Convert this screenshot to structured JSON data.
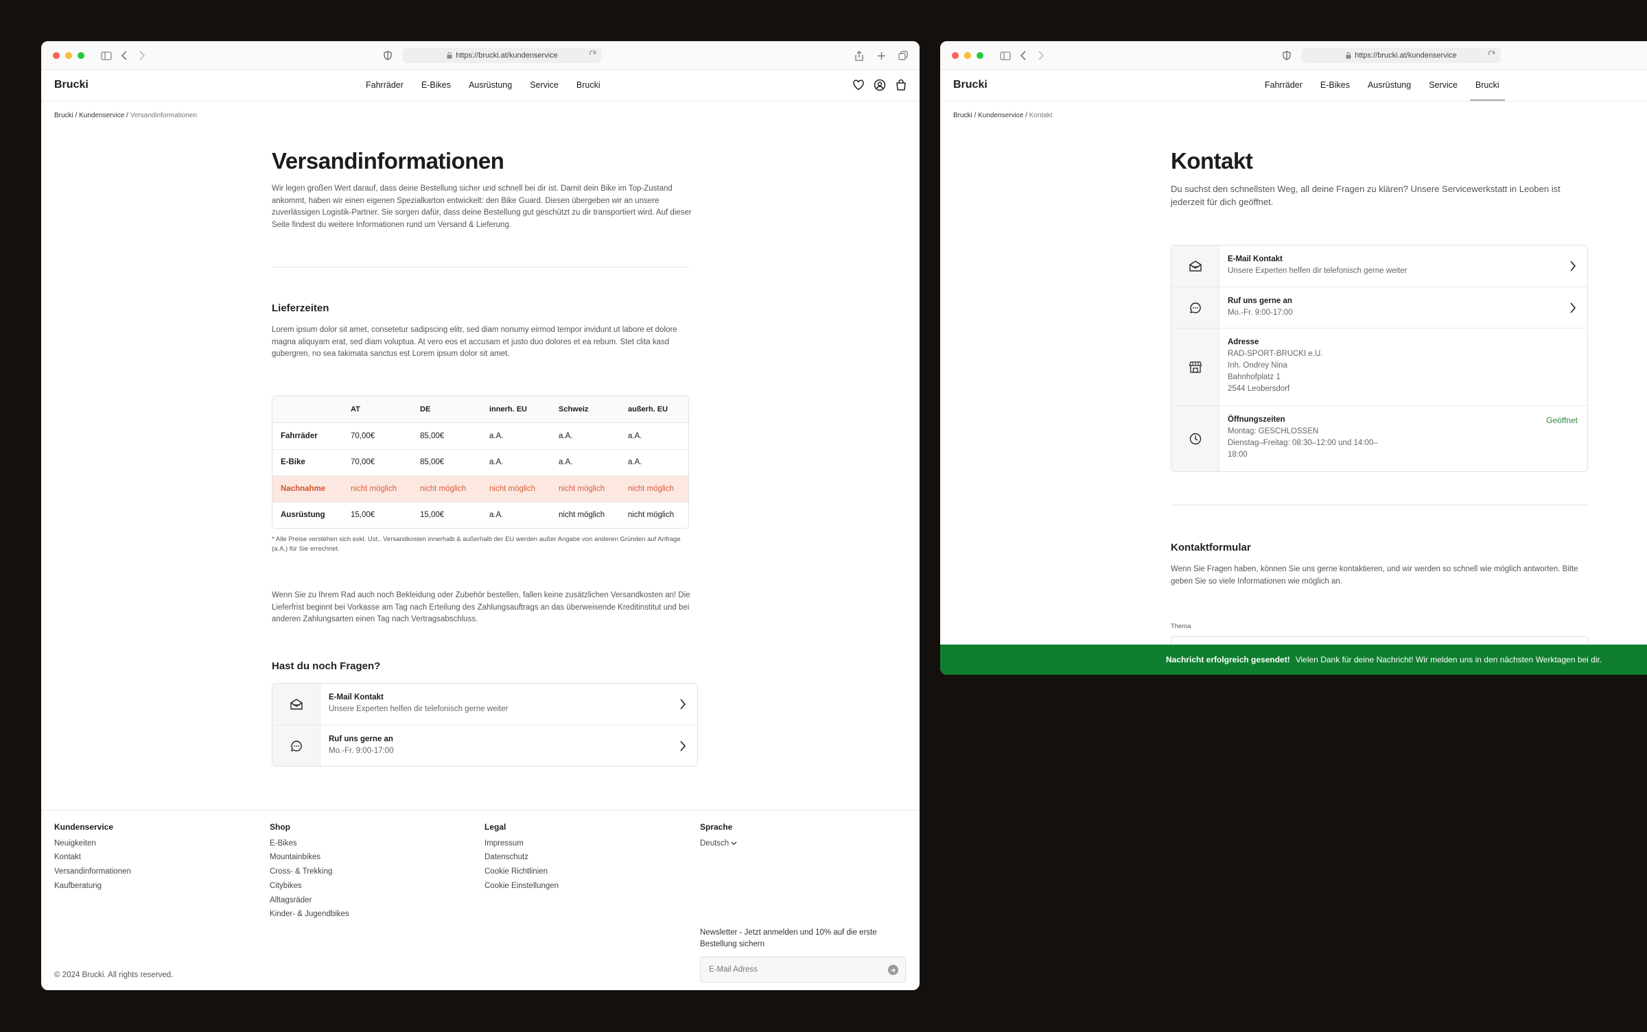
{
  "browser": {
    "url": "https://brucki.at/kundenservice"
  },
  "nav": {
    "logo": "Brucki",
    "items": [
      "Fahrräder",
      "E-Bikes",
      "Ausrüstung",
      "Service",
      "Brucki"
    ]
  },
  "left": {
    "breadcrumb": {
      "home": "Brucki",
      "sep": " / ",
      "section": "Kundenservice",
      "current": "Versandinformationen"
    },
    "title": "Versandinformationen",
    "intro": "Wir legen großen Wert darauf, dass deine Bestellung sicher und schnell bei dir ist. Damit dein Bike im Top-Zustand ankommt, haben wir einen eigenen Spezialkarton entwickelt: den Bike Guard. Diesen übergeben wir an unsere zuverlässigen Logistik-Partner. Sie sorgen dafür, dass deine Bestellung gut geschützt zu dir transportiert wird. Auf dieser Seite findest du weitere Informationen rund um Versand & Lieferung.",
    "lieferzeiten": {
      "heading": "Lieferzeiten",
      "text": "Lorem ipsum dolor sit amet, consetetur sadipscing elitr, sed diam nonumy eirmod tempor invidunt ut labore et dolore magna aliquyam erat, sed diam voluptua. At vero eos et accusam et justo duo dolores et ea rebum. Stet clita kasd gubergren, no sea takimata sanctus est Lorem ipsum dolor sit amet."
    },
    "table": {
      "headers": [
        "",
        "AT",
        "DE",
        "innerh. EU",
        "Schweiz",
        "außerh. EU"
      ],
      "rows": [
        [
          "Fahrräder",
          "70,00€",
          "85,00€",
          "a.A.",
          "a.A.",
          "a.A."
        ],
        [
          "E-Bike",
          "70,00€",
          "85,00€",
          "a.A.",
          "a.A.",
          "a.A."
        ],
        [
          "Nachnahme",
          "nicht möglich",
          "nicht möglich",
          "nicht möglich",
          "nicht möglich",
          "nicht möglich"
        ],
        [
          "Ausrüstung",
          "15,00€",
          "15,00€",
          "a.A.",
          "nicht möglich",
          "nicht möglich"
        ]
      ]
    },
    "footnote": "* Alle Preise verstehen sich exkl. Ust.. Versandkosten innerhalb & außerhalb der EU werden außer Angabe von anderen Gründen auf Anfrage (a.A.) für Sie errechnet.",
    "shipping_text": "Wenn Sie zu Ihrem Rad auch noch Bekleidung oder Zubehör bestellen, fallen keine zusätzlichen Versandkosten an! Die Lieferfrist beginnt bei Vorkasse am Tag nach Erteilung des Zahlungsauftrags an das überweisende Kreditinstitut und bei anderen Zahlungsarten einen Tag nach Vertragsabschluss.",
    "questions_heading": "Hast du noch Fragen?"
  },
  "contact_cards": {
    "email": {
      "title": "E-Mail Kontakt",
      "sub": "Unsere Experten helfen dir telefonisch gerne weiter"
    },
    "phone": {
      "title": "Ruf uns gerne an",
      "sub": "Mo.-Fr. 9:00-17:00"
    },
    "address": {
      "title": "Adresse",
      "lines": [
        "RAD-SPORT-BRUCKI e.U.",
        "Inh. Ondrey Nina",
        "Bahnhofplatz 1",
        "2544 Leobersdorf"
      ]
    },
    "hours": {
      "title": "Öffnungszeiten",
      "status": "Geöffnet",
      "lines": [
        "Montag: GESCHLOSSEN",
        "Dienstag–Freitag: 08:30–12:00 und 14:00–",
        "18:00"
      ]
    }
  },
  "footer": {
    "kundenservice": {
      "heading": "Kundenservice",
      "links": [
        "Neuigkeiten",
        "Kontakt",
        "Versandinformationen",
        "Kaufberatung"
      ]
    },
    "shop": {
      "heading": "Shop",
      "links": [
        "E-Bikes",
        "Mountainbikes",
        "Cross- & Trekking",
        "Citybikes",
        "Alltagsräder",
        "Kinder- & Jugendbikes"
      ]
    },
    "legal": {
      "heading": "Legal",
      "links": [
        "Impressum",
        "Datenschutz",
        "Cookie Richtlinien",
        "Cookie Einstellungen"
      ]
    },
    "sprache": {
      "heading": "Sprache",
      "value": "Deutsch"
    },
    "newsletter": {
      "text": "Newsletter - Jetzt anmelden und 10% auf die erste Bestellung sichern",
      "placeholder": "E-Mail Adress"
    },
    "copyright": "© 2024 Brucki. All rights reserved."
  },
  "right": {
    "breadcrumb": {
      "home": "Brucki",
      "sep": " / ",
      "section": "Kundenservice",
      "current": "Kontakt"
    },
    "title": "Kontakt",
    "intro": "Du suchst den schnellsten Weg, all deine Fragen zu klären? Unsere Servicewerkstatt in Leoben ist jederzeit für dich geöffnet.",
    "form": {
      "heading": "Kontaktformular",
      "text": "Wenn Sie Fragen haben, können Sie uns gerne kontaktieren, und wir werden so schnell wie möglich antworten. Bitte geben Sie so viele Informationen wie möglich an.",
      "topic_label": "Thema"
    },
    "toast": {
      "bold": "Nachricht erfolgreich gesendet!",
      "text": "Vielen Dank für deine Nachricht! Wir melden uns in den nächsten Werktagen bei dir."
    }
  }
}
